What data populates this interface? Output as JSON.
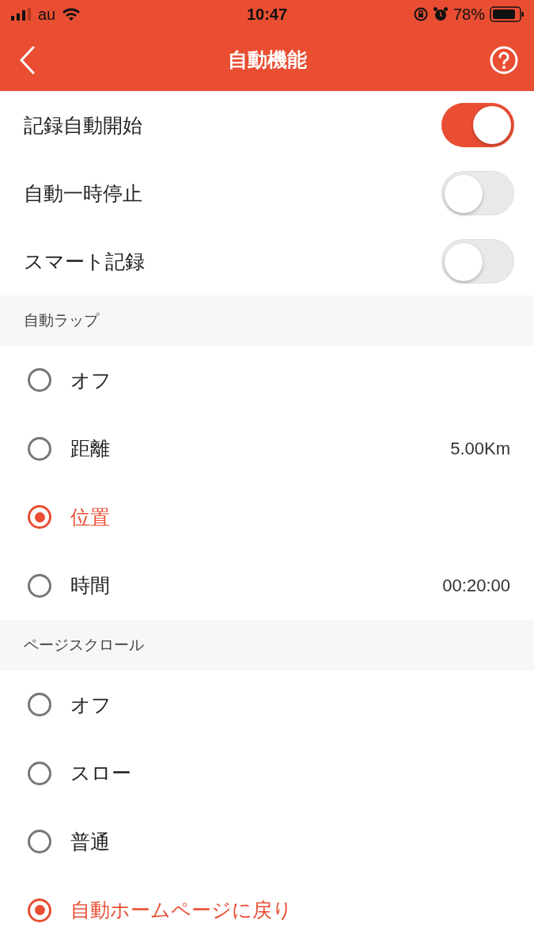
{
  "status_bar": {
    "carrier": "au",
    "time": "10:47",
    "battery": "78%"
  },
  "nav": {
    "title": "自動機能"
  },
  "toggles": [
    {
      "label": "記録自動開始",
      "on": true
    },
    {
      "label": "自動一時停止",
      "on": false
    },
    {
      "label": "スマート記録",
      "on": false
    }
  ],
  "sections": [
    {
      "title": "自動ラップ",
      "options": [
        {
          "label": "オフ",
          "selected": false
        },
        {
          "label": "距離",
          "value": "5.00Km",
          "selected": false
        },
        {
          "label": "位置",
          "selected": true
        },
        {
          "label": "時間",
          "value": "00:20:00",
          "selected": false
        }
      ]
    },
    {
      "title": "ページスクロール",
      "options": [
        {
          "label": "オフ",
          "selected": false
        },
        {
          "label": "スロー",
          "selected": false
        },
        {
          "label": "普通",
          "selected": false
        },
        {
          "label": "自動ホームページに戻り",
          "selected": true
        }
      ]
    }
  ]
}
